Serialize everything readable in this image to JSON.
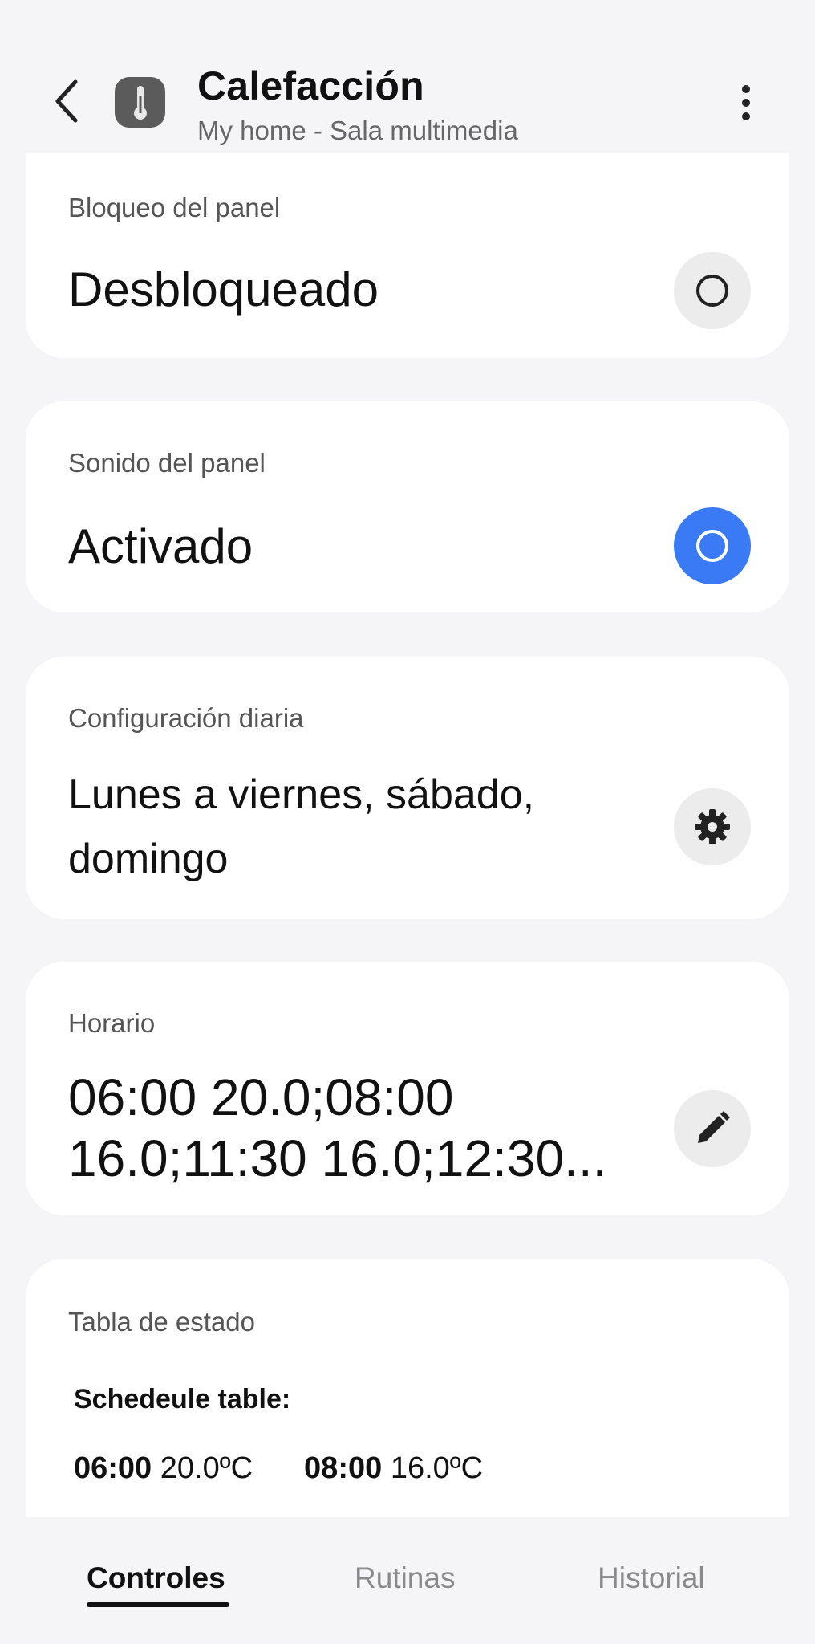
{
  "header": {
    "title": "Calefacción",
    "subtitle": "My home - Sala multimedia"
  },
  "cards": {
    "panel_lock": {
      "label": "Bloqueo del panel",
      "value": "Desbloqueado",
      "active": false
    },
    "panel_sound": {
      "label": "Sonido del panel",
      "value": "Activado",
      "active": true
    },
    "daily_config": {
      "label": "Configuración diaria",
      "value_line1": "Lunes a viernes, sábado,",
      "value_line2": "domingo"
    },
    "schedule": {
      "label": "Horario",
      "value_line1": "06:00 20.0;08:00",
      "value_line2": "16.0;11:30 16.0;12:30..."
    },
    "status_table": {
      "label": "Tabla de estado",
      "heading": "Schedeule table:",
      "entries": [
        {
          "time": "06:00",
          "temp": "20.0ºC"
        },
        {
          "time": "08:00",
          "temp": "16.0ºC"
        }
      ]
    }
  },
  "tabs": [
    {
      "label": "Controles",
      "active": true
    },
    {
      "label": "Rutinas",
      "active": false
    },
    {
      "label": "Historial",
      "active": false
    }
  ],
  "colors": {
    "accent": "#3a7bf5",
    "background": "#f5f5f7",
    "card": "#ffffff"
  },
  "icons": [
    "back-chevron-icon",
    "thermometer-icon",
    "more-vert-icon",
    "circle-toggle-icon",
    "gear-icon",
    "pencil-icon"
  ]
}
